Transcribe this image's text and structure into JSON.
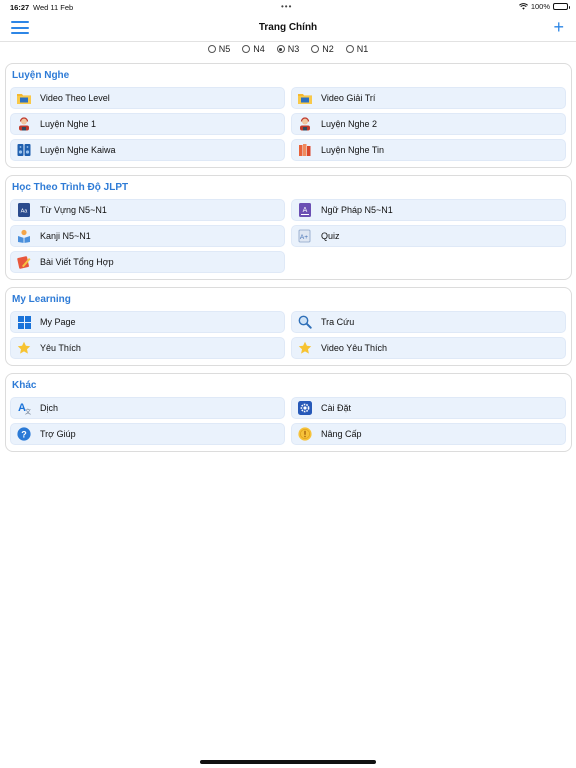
{
  "status_bar": {
    "time": "16:27",
    "date": "Wed 11 Feb",
    "battery": "100%"
  },
  "navbar": {
    "title": "Trang Chính",
    "menu_icon": "hamburger-icon",
    "add_icon": "plus-icon"
  },
  "levels": [
    {
      "label": "N5",
      "selected": false
    },
    {
      "label": "N4",
      "selected": false
    },
    {
      "label": "N3",
      "selected": true
    },
    {
      "label": "N2",
      "selected": false
    },
    {
      "label": "N1",
      "selected": false
    }
  ],
  "sections": {
    "listening": {
      "title": "Luyện Nghe",
      "items": [
        "Video Theo Level",
        "Video Giải Trí",
        "Luyện Nghe 1",
        "Luyện Nghe 2",
        "Luyện Nghe Kaiwa",
        "Luyện Nghe Tin"
      ]
    },
    "jlpt": {
      "title": "Học Theo Trình Độ JLPT",
      "items": [
        "Từ Vựng N5~N1",
        "Ngữ Pháp N5~N1",
        "Kanji N5~N1",
        "Quiz",
        "Bài Viết Tổng Hợp"
      ]
    },
    "my_learning": {
      "title": "My Learning",
      "items": [
        "My Page",
        "Tra Cứu",
        "Yêu Thích",
        "Video Yêu Thích"
      ]
    },
    "other": {
      "title": "Khác",
      "items": [
        "Dịch",
        "Cài Đặt",
        "Trợ Giúp",
        "Nâng Cấp"
      ]
    }
  },
  "colors": {
    "accent": "#2d86e6",
    "section_title": "#2e7bd6",
    "item_bg": "#eaf2fc"
  }
}
